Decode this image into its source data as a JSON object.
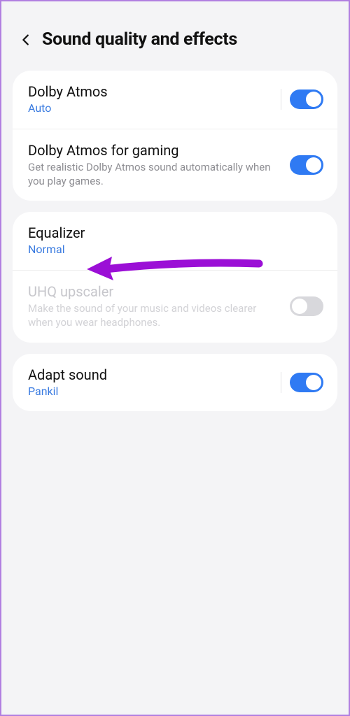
{
  "header": {
    "title": "Sound quality and effects"
  },
  "groups": [
    {
      "rows": [
        {
          "title": "Dolby Atmos",
          "sub": "Auto",
          "toggle": "on",
          "divider": true
        },
        {
          "title": "Dolby Atmos for gaming",
          "desc": "Get realistic Dolby Atmos sound automatically when you play games.",
          "toggle": "on"
        }
      ]
    },
    {
      "rows": [
        {
          "title": "Equalizer",
          "sub": "Normal"
        },
        {
          "title": "UHQ upscaler",
          "desc": "Make the sound of your music and videos clearer when you wear headphones.",
          "toggle": "off",
          "disabled": true
        }
      ]
    },
    {
      "rows": [
        {
          "title": "Adapt sound",
          "sub": "Pankil",
          "toggle": "on",
          "divider": true
        }
      ]
    }
  ],
  "annotation": {
    "color": "#9b0fd6"
  }
}
